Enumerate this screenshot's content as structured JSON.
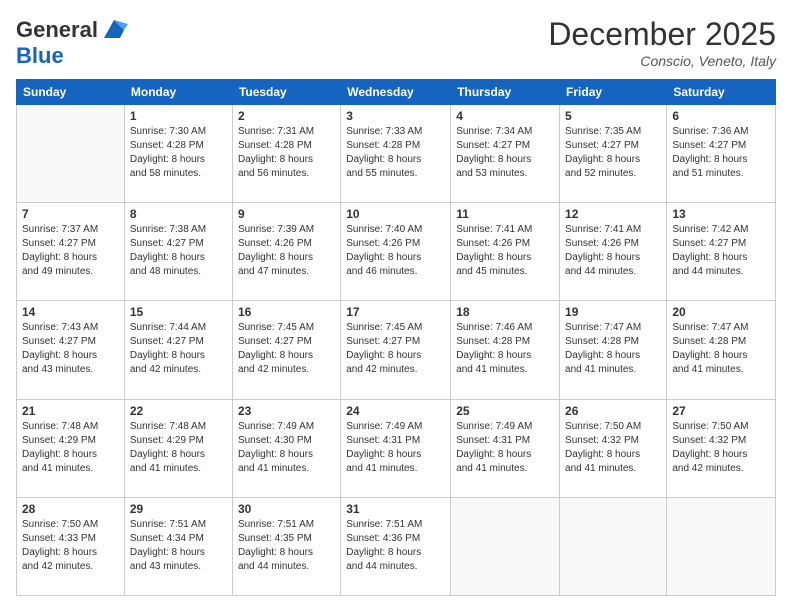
{
  "header": {
    "logo_general": "General",
    "logo_blue": "Blue",
    "month_title": "December 2025",
    "location": "Conscio, Veneto, Italy"
  },
  "weekdays": [
    "Sunday",
    "Monday",
    "Tuesday",
    "Wednesday",
    "Thursday",
    "Friday",
    "Saturday"
  ],
  "weeks": [
    [
      {
        "day": "",
        "info": ""
      },
      {
        "day": "1",
        "info": "Sunrise: 7:30 AM\nSunset: 4:28 PM\nDaylight: 8 hours\nand 58 minutes."
      },
      {
        "day": "2",
        "info": "Sunrise: 7:31 AM\nSunset: 4:28 PM\nDaylight: 8 hours\nand 56 minutes."
      },
      {
        "day": "3",
        "info": "Sunrise: 7:33 AM\nSunset: 4:28 PM\nDaylight: 8 hours\nand 55 minutes."
      },
      {
        "day": "4",
        "info": "Sunrise: 7:34 AM\nSunset: 4:27 PM\nDaylight: 8 hours\nand 53 minutes."
      },
      {
        "day": "5",
        "info": "Sunrise: 7:35 AM\nSunset: 4:27 PM\nDaylight: 8 hours\nand 52 minutes."
      },
      {
        "day": "6",
        "info": "Sunrise: 7:36 AM\nSunset: 4:27 PM\nDaylight: 8 hours\nand 51 minutes."
      }
    ],
    [
      {
        "day": "7",
        "info": "Sunrise: 7:37 AM\nSunset: 4:27 PM\nDaylight: 8 hours\nand 49 minutes."
      },
      {
        "day": "8",
        "info": "Sunrise: 7:38 AM\nSunset: 4:27 PM\nDaylight: 8 hours\nand 48 minutes."
      },
      {
        "day": "9",
        "info": "Sunrise: 7:39 AM\nSunset: 4:26 PM\nDaylight: 8 hours\nand 47 minutes."
      },
      {
        "day": "10",
        "info": "Sunrise: 7:40 AM\nSunset: 4:26 PM\nDaylight: 8 hours\nand 46 minutes."
      },
      {
        "day": "11",
        "info": "Sunrise: 7:41 AM\nSunset: 4:26 PM\nDaylight: 8 hours\nand 45 minutes."
      },
      {
        "day": "12",
        "info": "Sunrise: 7:41 AM\nSunset: 4:26 PM\nDaylight: 8 hours\nand 44 minutes."
      },
      {
        "day": "13",
        "info": "Sunrise: 7:42 AM\nSunset: 4:27 PM\nDaylight: 8 hours\nand 44 minutes."
      }
    ],
    [
      {
        "day": "14",
        "info": "Sunrise: 7:43 AM\nSunset: 4:27 PM\nDaylight: 8 hours\nand 43 minutes."
      },
      {
        "day": "15",
        "info": "Sunrise: 7:44 AM\nSunset: 4:27 PM\nDaylight: 8 hours\nand 42 minutes."
      },
      {
        "day": "16",
        "info": "Sunrise: 7:45 AM\nSunset: 4:27 PM\nDaylight: 8 hours\nand 42 minutes."
      },
      {
        "day": "17",
        "info": "Sunrise: 7:45 AM\nSunset: 4:27 PM\nDaylight: 8 hours\nand 42 minutes."
      },
      {
        "day": "18",
        "info": "Sunrise: 7:46 AM\nSunset: 4:28 PM\nDaylight: 8 hours\nand 41 minutes."
      },
      {
        "day": "19",
        "info": "Sunrise: 7:47 AM\nSunset: 4:28 PM\nDaylight: 8 hours\nand 41 minutes."
      },
      {
        "day": "20",
        "info": "Sunrise: 7:47 AM\nSunset: 4:28 PM\nDaylight: 8 hours\nand 41 minutes."
      }
    ],
    [
      {
        "day": "21",
        "info": "Sunrise: 7:48 AM\nSunset: 4:29 PM\nDaylight: 8 hours\nand 41 minutes."
      },
      {
        "day": "22",
        "info": "Sunrise: 7:48 AM\nSunset: 4:29 PM\nDaylight: 8 hours\nand 41 minutes."
      },
      {
        "day": "23",
        "info": "Sunrise: 7:49 AM\nSunset: 4:30 PM\nDaylight: 8 hours\nand 41 minutes."
      },
      {
        "day": "24",
        "info": "Sunrise: 7:49 AM\nSunset: 4:31 PM\nDaylight: 8 hours\nand 41 minutes."
      },
      {
        "day": "25",
        "info": "Sunrise: 7:49 AM\nSunset: 4:31 PM\nDaylight: 8 hours\nand 41 minutes."
      },
      {
        "day": "26",
        "info": "Sunrise: 7:50 AM\nSunset: 4:32 PM\nDaylight: 8 hours\nand 41 minutes."
      },
      {
        "day": "27",
        "info": "Sunrise: 7:50 AM\nSunset: 4:32 PM\nDaylight: 8 hours\nand 42 minutes."
      }
    ],
    [
      {
        "day": "28",
        "info": "Sunrise: 7:50 AM\nSunset: 4:33 PM\nDaylight: 8 hours\nand 42 minutes."
      },
      {
        "day": "29",
        "info": "Sunrise: 7:51 AM\nSunset: 4:34 PM\nDaylight: 8 hours\nand 43 minutes."
      },
      {
        "day": "30",
        "info": "Sunrise: 7:51 AM\nSunset: 4:35 PM\nDaylight: 8 hours\nand 44 minutes."
      },
      {
        "day": "31",
        "info": "Sunrise: 7:51 AM\nSunset: 4:36 PM\nDaylight: 8 hours\nand 44 minutes."
      },
      {
        "day": "",
        "info": ""
      },
      {
        "day": "",
        "info": ""
      },
      {
        "day": "",
        "info": ""
      }
    ]
  ]
}
